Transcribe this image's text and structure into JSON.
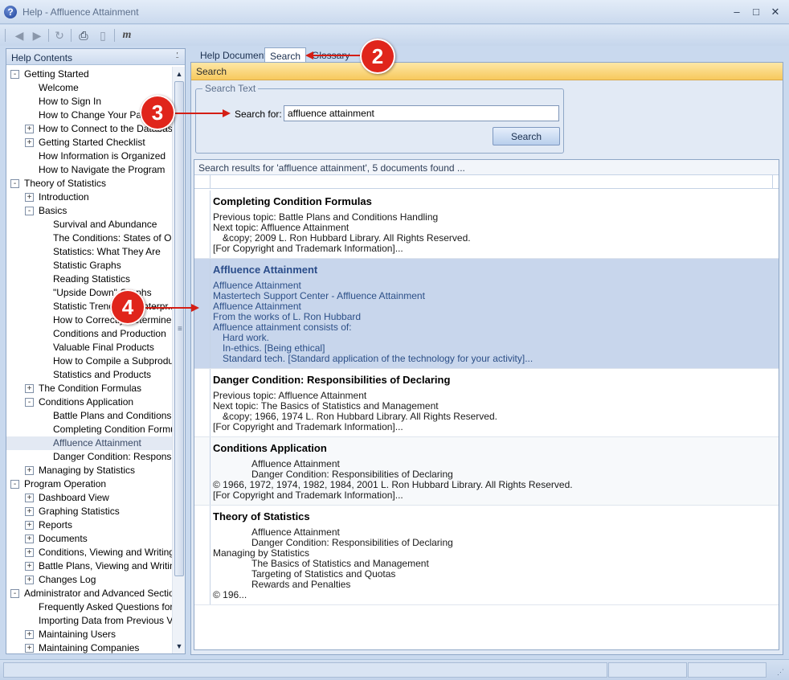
{
  "window": {
    "title": "Help - Affluence Attainment",
    "minimize": "–",
    "maximize": "□",
    "close": "✕"
  },
  "toolbar": {
    "back_icon": "◀",
    "forward_icon": "▶",
    "refresh_icon": "↻",
    "print_icon": "⎙",
    "page_icon": "▯",
    "m_icon": "m"
  },
  "left_panel": {
    "title": "Help Contents",
    "pin_icon": "⍘"
  },
  "tree": [
    {
      "label": "Getting Started",
      "level": 0,
      "expander": "-"
    },
    {
      "label": "Welcome",
      "level": 1,
      "expander": ""
    },
    {
      "label": "How to Sign In",
      "level": 1,
      "expander": ""
    },
    {
      "label": "How to Change Your Pass",
      "level": 1,
      "expander": ""
    },
    {
      "label": "How to Connect to the Database",
      "level": 1,
      "expander": "+"
    },
    {
      "label": "Getting Started Checklist",
      "level": 1,
      "expander": "+"
    },
    {
      "label": "How Information is Organized",
      "level": 1,
      "expander": ""
    },
    {
      "label": "How to Navigate the Program",
      "level": 1,
      "expander": ""
    },
    {
      "label": "Theory of Statistics",
      "level": 0,
      "expander": "-"
    },
    {
      "label": "Introduction",
      "level": 1,
      "expander": "+"
    },
    {
      "label": "Basics",
      "level": 1,
      "expander": "-"
    },
    {
      "label": "Survival and Abundance",
      "level": 2,
      "expander": ""
    },
    {
      "label": "The Conditions: States of O...",
      "level": 2,
      "expander": ""
    },
    {
      "label": "Statistics: What They Are",
      "level": 2,
      "expander": ""
    },
    {
      "label": "Statistic Graphs",
      "level": 2,
      "expander": ""
    },
    {
      "label": "Reading Statistics",
      "level": 2,
      "expander": ""
    },
    {
      "label": "\"Upside Down\" Graphs",
      "level": 2,
      "expander": ""
    },
    {
      "label": "Statistic Trends and Interpr...",
      "level": 2,
      "expander": ""
    },
    {
      "label": "How to Correctly Determine ...",
      "level": 2,
      "expander": ""
    },
    {
      "label": "Conditions and Production",
      "level": 2,
      "expander": ""
    },
    {
      "label": "Valuable Final Products",
      "level": 2,
      "expander": ""
    },
    {
      "label": "How to Compile a Subprodu...",
      "level": 2,
      "expander": ""
    },
    {
      "label": "Statistics and Products",
      "level": 2,
      "expander": ""
    },
    {
      "label": "The Condition Formulas",
      "level": 1,
      "expander": "+"
    },
    {
      "label": "Conditions Application",
      "level": 1,
      "expander": "-"
    },
    {
      "label": "Battle Plans and Conditions ...",
      "level": 2,
      "expander": ""
    },
    {
      "label": "Completing Condition Formu...",
      "level": 2,
      "expander": ""
    },
    {
      "label": "Affluence Attainment",
      "level": 2,
      "expander": "",
      "selected": true
    },
    {
      "label": "Danger Condition: Responsi...",
      "level": 2,
      "expander": ""
    },
    {
      "label": "Managing by Statistics",
      "level": 1,
      "expander": "+"
    },
    {
      "label": "Program Operation",
      "level": 0,
      "expander": "-"
    },
    {
      "label": "Dashboard View",
      "level": 1,
      "expander": "+"
    },
    {
      "label": "Graphing Statistics",
      "level": 1,
      "expander": "+"
    },
    {
      "label": "Reports",
      "level": 1,
      "expander": "+"
    },
    {
      "label": "Documents",
      "level": 1,
      "expander": "+"
    },
    {
      "label": "Conditions, Viewing and Writing",
      "level": 1,
      "expander": "+"
    },
    {
      "label": "Battle Plans, Viewing and Writing",
      "level": 1,
      "expander": "+"
    },
    {
      "label": "Changes Log",
      "level": 1,
      "expander": "+"
    },
    {
      "label": "Administrator and Advanced Section",
      "level": 0,
      "expander": "-"
    },
    {
      "label": "Frequently Asked Questions for ...",
      "level": 1,
      "expander": ""
    },
    {
      "label": "Importing Data from Previous V...",
      "level": 1,
      "expander": ""
    },
    {
      "label": "Maintaining Users",
      "level": 1,
      "expander": "+"
    },
    {
      "label": "Maintaining Companies",
      "level": 1,
      "expander": "+"
    }
  ],
  "scrollbar": {
    "up": "▲",
    "down": "▼",
    "grip": "≡"
  },
  "tabs": [
    {
      "label": "Help Document",
      "active": false
    },
    {
      "label": "Search",
      "active": true
    },
    {
      "label": "Glossary",
      "active": false
    }
  ],
  "search": {
    "bar_title": "Search",
    "group_title": "Search Text",
    "label": "Search for:",
    "value": "affluence attainment",
    "button": "Search"
  },
  "results": {
    "summary": "Search results for 'affluence attainment', 5 documents found ...",
    "items": [
      {
        "title": "Completing Condition Formulas",
        "lines": [
          {
            "text": "Previous topic: Battle Plans and Conditions Handling",
            "indent": 0
          },
          {
            "text": "Next topic: Affluence Attainment",
            "indent": 0
          },
          {
            "text": "&copy; 2009 L. Ron Hubbard Library. All Rights Reserved.",
            "indent": 1
          },
          {
            "text": "[For Copyright and Trademark Information]...",
            "indent": 0
          }
        ]
      },
      {
        "title": "Affluence Attainment",
        "highlight": true,
        "lines": [
          {
            "text": "Affluence Attainment",
            "indent": 0
          },
          {
            "text": "Mastertech Support Center - Affluence Attainment",
            "indent": 0
          },
          {
            "text": "Affluence Attainment",
            "indent": 0
          },
          {
            "text": "From the works of L. Ron Hubbard",
            "indent": 0
          },
          {
            "text": "Affluence attainment consists of:",
            "indent": 0
          },
          {
            "text": "Hard work.",
            "indent": 1
          },
          {
            "text": "In-ethics. [Being ethical]",
            "indent": 1
          },
          {
            "text": "Standard tech. [Standard application of the technology for your activity]...",
            "indent": 1
          }
        ]
      },
      {
        "title": "Danger Condition: Responsibilities of Declaring",
        "lines": [
          {
            "text": "Previous topic: Affluence Attainment",
            "indent": 0
          },
          {
            "text": "Next topic: The Basics of Statistics and Management",
            "indent": 0
          },
          {
            "text": "&copy; 1966, 1974 L. Ron Hubbard Library. All Rights Reserved.",
            "indent": 1
          },
          {
            "text": "[For Copyright and Trademark Information]...",
            "indent": 0
          }
        ]
      },
      {
        "title": "Conditions Application",
        "alt": true,
        "lines": [
          {
            "text": "Affluence Attainment",
            "indent": 2
          },
          {
            "text": "Danger Condition: Responsibilities of Declaring",
            "indent": 2
          },
          {
            "text": "© 1966, 1972, 1974, 1982, 1984, 2001 L. Ron Hubbard Library. All Rights Reserved.",
            "indent": 0
          },
          {
            "text": "[For Copyright and Trademark Information]...",
            "indent": 0
          }
        ]
      },
      {
        "title": "Theory of Statistics",
        "lines": [
          {
            "text": "Affluence Attainment",
            "indent": 2
          },
          {
            "text": "Danger Condition: Responsibilities of Declaring",
            "indent": 2
          },
          {
            "text": "Managing by Statistics",
            "indent": 0
          },
          {
            "text": "The Basics of Statistics and Management",
            "indent": 2
          },
          {
            "text": "Targeting of Statistics and Quotas",
            "indent": 2
          },
          {
            "text": "Rewards and Penalties",
            "indent": 2
          },
          {
            "text": "© 196...",
            "indent": 0
          }
        ]
      }
    ]
  },
  "callouts": [
    "2",
    "3",
    "4"
  ],
  "colors": {
    "callout": "#e0251b",
    "search_bar": "#f7c95d",
    "highlight": "#c8d6ec"
  }
}
